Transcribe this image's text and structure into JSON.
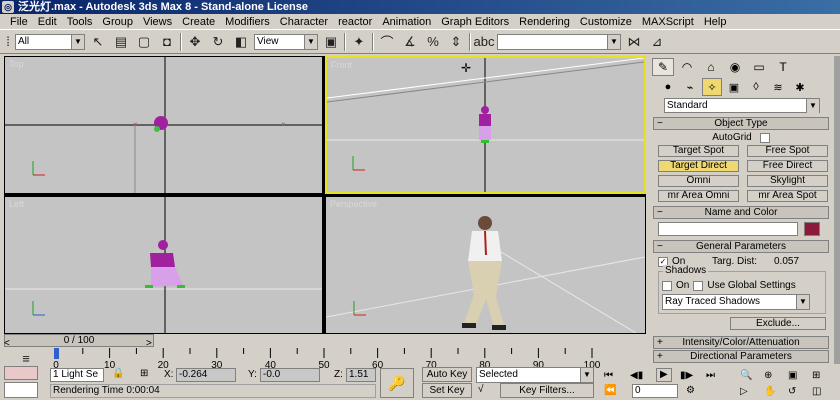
{
  "window": {
    "title": "泛光灯.max - Autodesk 3ds Max 8 - Stand-alone License"
  },
  "menu": [
    "File",
    "Edit",
    "Tools",
    "Group",
    "Views",
    "Create",
    "Modifiers",
    "Character",
    "reactor",
    "Animation",
    "Graph Editors",
    "Rendering",
    "Customize",
    "MAXScript",
    "Help"
  ],
  "toolbar": {
    "selection_filter": "All",
    "reference_coord": "View",
    "named_selection": ""
  },
  "viewports": {
    "top_label": "Top",
    "front_label": "Front",
    "left_label": "Left",
    "persp_label": "Perspective"
  },
  "command_panel": {
    "category": "Standard",
    "object_type": {
      "title": "Object Type",
      "autogrid_label": "AutoGrid",
      "buttons": [
        "Target Spot",
        "Free Spot",
        "Target Direct",
        "Free Direct",
        "Omni",
        "Skylight",
        "mr Area Omni",
        "mr Area Spot"
      ]
    },
    "name_color": {
      "title": "Name and Color",
      "name_value": "",
      "swatch_color": "#8c1a3c"
    },
    "general": {
      "title": "General Parameters",
      "on_label": "On",
      "targ_dist_label": "Targ. Dist:",
      "targ_dist_value": "0.057",
      "shadows_label": "Shadows",
      "shadows_on_label": "On",
      "use_global_label": "Use Global Settings",
      "shadow_type": "Ray Traced Shadows",
      "exclude_label": "Exclude..."
    },
    "intensity_title": "Intensity/Color/Attenuation",
    "directional_title": "Directional Parameters"
  },
  "timeline": {
    "slider_text": "0 / 100",
    "ticks": [
      "0",
      "10",
      "20",
      "30",
      "40",
      "50",
      "60",
      "70",
      "80",
      "90",
      "100"
    ]
  },
  "status": {
    "selected_count": "1 Light Se",
    "x_label": "X:",
    "x_value": "-0.264",
    "y_label": "Y:",
    "y_value": "-0.0",
    "z_label": "Z:",
    "z_value": "1.51",
    "rendering_time": "Rendering Time  0:00:04",
    "auto_key_label": "Auto Key",
    "set_key_label": "Set Key",
    "key_mode": "Selected",
    "key_filters_label": "Key Filters...",
    "frame_value": "0"
  }
}
